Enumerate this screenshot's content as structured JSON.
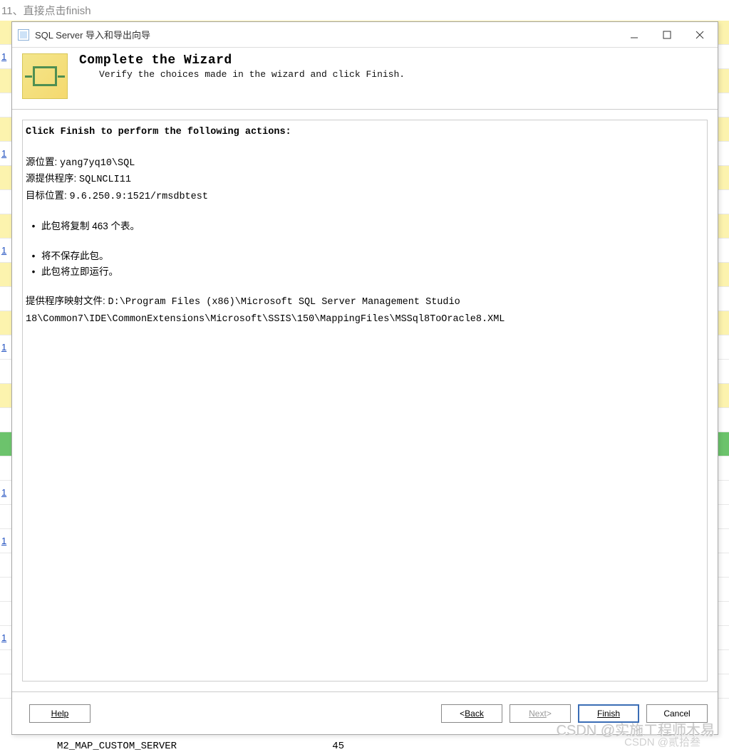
{
  "page": {
    "step_label": "11、直接点击finish"
  },
  "window": {
    "title": "SQL Server 导入和导出向导"
  },
  "header": {
    "title": "Complete the Wizard",
    "subtitle": "Verify the choices made in the wizard and click Finish."
  },
  "content": {
    "heading": "Click Finish to perform the following actions:",
    "source_location_label": "源位置: ",
    "source_location_value": "yang7yq10\\SQL",
    "source_provider_label": "源提供程序: ",
    "source_provider_value": "SQLNCLI11",
    "dest_location_label": "目标位置: ",
    "dest_location_value": "9.6.250.9:1521/rmsdbtest",
    "bullet_copy_tables": "此包将复制 463 个表。",
    "bullet_no_save": "将不保存此包。",
    "bullet_run_now": "此包将立即运行。",
    "mapping_label": "提供程序映射文件: ",
    "mapping_value": "D:\\Program Files (x86)\\Microsoft SQL Server Management Studio 18\\Common7\\IDE\\CommonExtensions\\Microsoft\\SSIS\\150\\MappingFiles\\MSSql8ToOracle8.XML"
  },
  "footer": {
    "help": "Help",
    "back_prefix": "< ",
    "back": "Back",
    "next": "Next",
    "next_suffix": " >",
    "finish": "Finish",
    "cancel": "Cancel"
  },
  "watermark": {
    "line1": "CSDN @实施工程师木易",
    "line2": "CSDN @贰拾叁"
  },
  "bg": {
    "numrow": "1",
    "bottom_left": "M2_MAP_CUSTOM_SERVER",
    "bottom_right": "45"
  }
}
